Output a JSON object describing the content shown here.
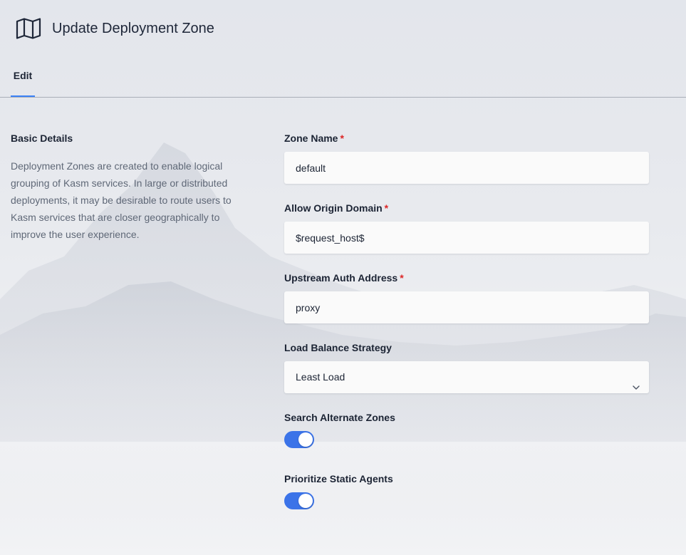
{
  "header": {
    "title": "Update Deployment Zone",
    "icon": "map-icon"
  },
  "tabs": [
    {
      "label": "Edit",
      "active": true
    }
  ],
  "basic_details": {
    "title": "Basic Details",
    "description": "Deployment Zones are created to enable logical grouping of Kasm services. In large or distributed deployments, it may be desirable to route users to Kasm services that are closer geographically to improve the user experience."
  },
  "form": {
    "required_marker": "*",
    "zone_name": {
      "label": "Zone Name",
      "value": "default",
      "required": true
    },
    "allow_origin_domain": {
      "label": "Allow Origin Domain",
      "value": "$request_host$",
      "required": true
    },
    "upstream_auth_address": {
      "label": "Upstream Auth Address",
      "value": "proxy",
      "required": true
    },
    "load_balance_strategy": {
      "label": "Load Balance Strategy",
      "selected": "Least Load"
    },
    "search_alternate_zones": {
      "label": "Search Alternate Zones",
      "enabled": true
    },
    "prioritize_static_agents": {
      "label": "Prioritize Static Agents",
      "enabled": true
    }
  },
  "colors": {
    "accent": "#3b82f6",
    "toggle_on": "#3b73e8",
    "required": "#dc2626"
  }
}
